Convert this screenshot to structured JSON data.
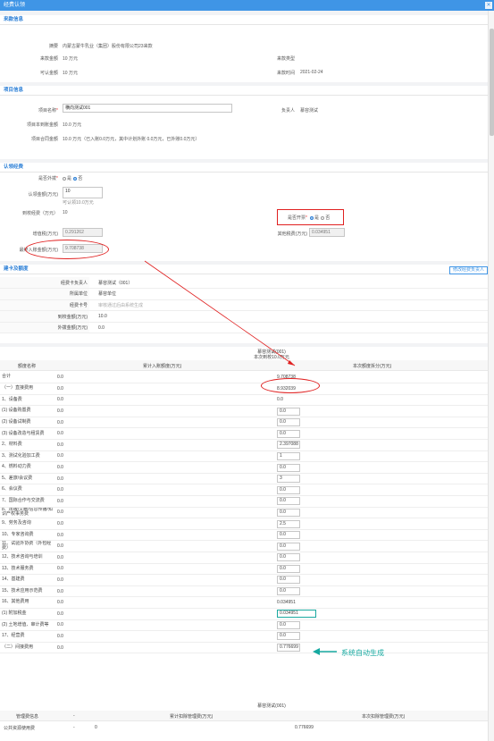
{
  "window": {
    "title": "经费认领",
    "close": "✕"
  },
  "funding_basis": {
    "title": "来款信息",
    "summary_label": "摘要",
    "summary_value": "内蒙古蒙牛乳业（集团）股份有限公司23来款",
    "amount_label": "来款金额",
    "amount_value": "10 万元",
    "type_label": "来款类型",
    "type_value": "",
    "claimable_label": "可认金额",
    "claimable_value": "10 万元",
    "time_label": "来款时间",
    "time_value": "2021-02-24"
  },
  "project_info": {
    "title": "项目信息",
    "name_label": "项目名称",
    "name_value": "横向测试001",
    "leader_label": "负责人",
    "leader_value": "慕容测试",
    "contract_label": "项目本到账金额",
    "contract_value": "10.0 万元",
    "total_label": "项目合同金额",
    "total_value": "10.0 万元（已入账0.0万元，其中计划外账 0.0万元，已外账0.0万元）"
  },
  "claim_funding": {
    "title": "认领经费",
    "outbound_label": "是否外拨",
    "yes": "是",
    "no": "否",
    "amount_label": "认领金额(万元)",
    "amount_value": "10",
    "amount_hint": "可认领10.0万元",
    "recv_label": "到校经费（万元）",
    "recv_value": "10",
    "mgmt_label": "是否开票",
    "mgmt_yes": "是",
    "mgmt_no": "否",
    "tax_label": "增值税(万元)",
    "tax_value": "0.291262",
    "other_tax_label": "其他税费(万元)",
    "other_tax_value": "0.034951",
    "final_label": "最终入账金额(万元)",
    "final_value": "9.708738"
  },
  "budget": {
    "title": "建卡及额度",
    "edit_button": "修改经费负责人",
    "rows": [
      {
        "label": "经费卡负责人",
        "value": "慕容测试（001）"
      },
      {
        "label": "所属单位",
        "value": "慕容单位"
      },
      {
        "label": "经费卡号",
        "value": "审核通过后由系统生成"
      },
      {
        "label": "到校金额(万元)",
        "value": "10.0"
      },
      {
        "label": "外拨金额(万元)",
        "value": "0.0"
      }
    ]
  },
  "split_table": {
    "person": "慕容测试(001)",
    "sub": "本次到校10.0万元",
    "col_name": "额度名称",
    "col_total": "累计入账额度(万元)",
    "col_this": "本次额度拆分(万元)",
    "rows": [
      {
        "name": "合计",
        "total": "0.0",
        "this": "9.708738",
        "kind": "text"
      },
      {
        "name": "（一）直接费用",
        "total": "0.0",
        "this": "8.932039",
        "kind": "text"
      },
      {
        "name": "1、设备费",
        "total": "0.0",
        "this": "0.0",
        "kind": "text"
      },
      {
        "name": "(1) 设备购置费",
        "total": "0.0",
        "this": "0.0",
        "kind": "input"
      },
      {
        "name": "(2) 设备试制费",
        "total": "0.0",
        "this": "0.0",
        "kind": "input"
      },
      {
        "name": "(3) 设备改造与租赁费",
        "total": "0.0",
        "this": "0.0",
        "kind": "input"
      },
      {
        "name": "2、材料费",
        "total": "0.0",
        "this": "2.397088",
        "kind": "input"
      },
      {
        "name": "3、测试化验加工费",
        "total": "0.0",
        "this": "1",
        "kind": "input"
      },
      {
        "name": "4、燃料动力费",
        "total": "0.0",
        "this": "0.0",
        "kind": "input"
      },
      {
        "name": "5、差旅/会议费",
        "total": "0.0",
        "this": "3",
        "kind": "input"
      },
      {
        "name": "6、会议费",
        "total": "0.0",
        "this": "0.0",
        "kind": "input"
      },
      {
        "name": "7、国际合作与交流费",
        "total": "0.0",
        "this": "0.0",
        "kind": "input"
      },
      {
        "name": "8、出版/文献/信息传播/知识产权事务费",
        "total": "0.0",
        "this": "0.0",
        "kind": "input"
      },
      {
        "name": "9、劳务及咨询",
        "total": "0.0",
        "this": "2.5",
        "kind": "input"
      },
      {
        "name": "10、专家咨询费",
        "total": "0.0",
        "this": "0.0",
        "kind": "input"
      },
      {
        "name": "11、试验外协费（外包经费）",
        "total": "0.0",
        "this": "0.0",
        "kind": "input"
      },
      {
        "name": "12、技术咨询与培训",
        "total": "0.0",
        "this": "0.0",
        "kind": "input"
      },
      {
        "name": "13、技术服务费",
        "total": "0.0",
        "this": "0.0",
        "kind": "input"
      },
      {
        "name": "14、基建费",
        "total": "0.0",
        "this": "0.0",
        "kind": "input"
      },
      {
        "name": "15、技术应用示范费",
        "total": "0.0",
        "this": "0.0",
        "kind": "input"
      },
      {
        "name": "16、其他费用",
        "total": "0.0",
        "this": "0.034951",
        "kind": "text"
      },
      {
        "name": "(1) 附加税金",
        "total": "0.0",
        "this": "0.034951",
        "kind": "hl"
      },
      {
        "name": "(2) 土地增值、审计费等",
        "total": "0.0",
        "this": "0.0",
        "kind": "input"
      },
      {
        "name": "17、经营费",
        "total": "0.0",
        "this": "0.0",
        "kind": "input"
      },
      {
        "name": "（二）间接费用",
        "total": "0.0",
        "this": "0.776699",
        "kind": "input"
      }
    ]
  },
  "annotation": {
    "text": "系统自动生成"
  },
  "mgmt_table": {
    "person": "慕容测试(001)",
    "col_name": "管理费信息",
    "col_dash": "-",
    "col_total": "累计扣除管理费(万元)",
    "col_this": "本次扣除管理费(万元)",
    "row_name": "公共资源使用费",
    "row_dash": "-",
    "row_total": "0",
    "row_this": "0.776699"
  },
  "colors": {
    "accent": "#3f95e6",
    "highlight": "#e02020",
    "annotation": "#16a9a0"
  }
}
